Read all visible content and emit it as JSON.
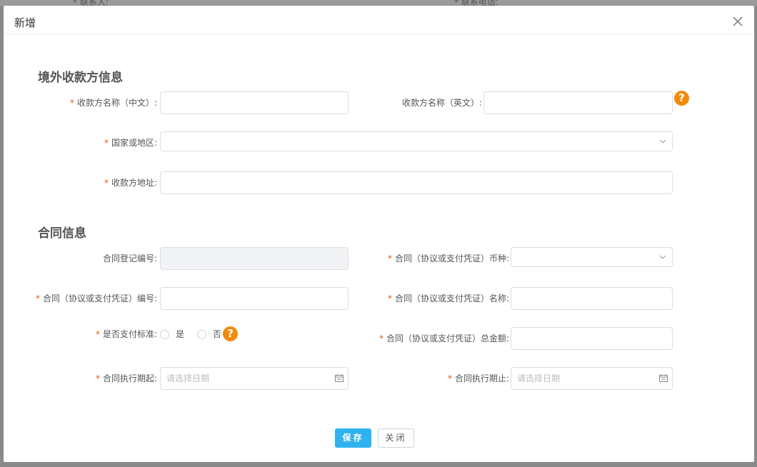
{
  "background": {
    "hint_left": "* 联系人:",
    "hint_right": "* 联系电话:"
  },
  "modal": {
    "title": "新增",
    "close_icon": "close-icon"
  },
  "sections": {
    "payee": "境外收款方信息",
    "contract": "合同信息"
  },
  "payee": {
    "name_cn_label": "收款方名称（中文）:",
    "name_cn_value": "",
    "name_en_label": "收款方名称（英文）:",
    "name_en_value": "",
    "country_label": "国家或地区:",
    "country_value": "",
    "address_label": "收款方地址:",
    "address_value": ""
  },
  "contract": {
    "reg_no_label": "合同登记编号:",
    "reg_no_value": "",
    "currency_label": "合同（协议或支付凭证）币种:",
    "currency_value": "",
    "contract_no_label": "合同（协议或支付凭证）编号:",
    "contract_no_value": "",
    "contract_name_label": "合同（协议或支付凭证）名称:",
    "contract_name_value": "",
    "pay_standard_label": "是否支付标准:",
    "yes_label": "是",
    "no_label": "否",
    "total_amount_label": "合同（协议或支付凭证）总金额:",
    "total_amount_value": "",
    "start_label": "合同执行期起:",
    "start_placeholder": "请选择日期",
    "end_label": "合同执行期止:",
    "end_placeholder": "请选择日期"
  },
  "buttons": {
    "save": "保存",
    "close": "关闭"
  },
  "colors": {
    "primary": "#2fb2ef",
    "required": "#e6590a",
    "help": "#f28a0c"
  }
}
